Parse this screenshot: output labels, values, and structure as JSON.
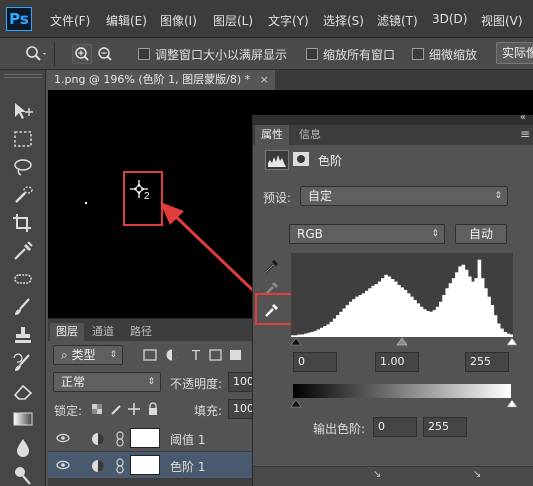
{
  "menubar": {
    "logo": "Ps",
    "items": [
      "文件(F)",
      "编辑(E)",
      "图像(I)",
      "图层(L)",
      "文字(Y)",
      "选择(S)",
      "滤镜(T)",
      "3D(D)",
      "视图(V)"
    ]
  },
  "options": {
    "resize_windows": "调整窗口大小以满屏显示",
    "zoom_all": "缩放所有窗口",
    "scrubby_zoom": "细微缩放",
    "actual_pixels": "实际像"
  },
  "document": {
    "tab_title": "1.png @ 196% (色阶 1, 图层蒙版/8) *",
    "close": "×"
  },
  "canvas": {
    "marker_label": "2"
  },
  "properties": {
    "tabs": [
      "属性",
      "信息"
    ],
    "collapse": "«",
    "menu": "≡",
    "adjustment_title": "色阶",
    "preset_label": "预设:",
    "preset_value": "自定",
    "channel_value": "RGB",
    "auto_button": "自动",
    "input_black": "0",
    "input_gamma": "1.00",
    "input_white": "255",
    "output_label": "输出色阶:",
    "output_black": "0",
    "output_white": "255",
    "histogram": [
      2,
      2,
      3,
      3,
      4,
      5,
      6,
      7,
      9,
      11,
      13,
      15,
      18,
      22,
      26,
      30,
      34,
      38,
      42,
      45,
      48,
      50,
      52,
      55,
      58,
      61,
      63,
      66,
      70,
      74,
      72,
      69,
      66,
      62,
      59,
      56,
      52,
      48,
      44,
      40,
      36,
      33,
      31,
      30,
      32,
      36,
      42,
      50,
      58,
      64,
      70,
      77,
      84,
      86,
      80,
      72,
      66,
      70,
      92,
      70,
      58,
      48,
      38,
      26,
      16,
      10,
      6,
      4,
      3
    ]
  },
  "layers": {
    "tabs": [
      "图层",
      "通道",
      "路径"
    ],
    "filter_label": "类型",
    "blend_mode": "正常",
    "opacity_label": "不透明度:",
    "opacity_value": "100",
    "lock_label": "锁定:",
    "fill_label": "填充:",
    "fill_value": "100",
    "rows": [
      {
        "name": "阈值 1"
      },
      {
        "name": "色阶 1"
      }
    ]
  }
}
